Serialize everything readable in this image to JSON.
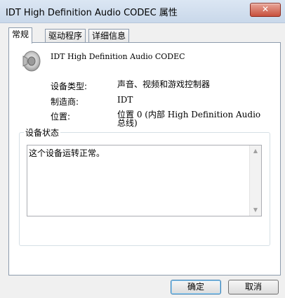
{
  "window": {
    "title": "IDT High Definition Audio CODEC 属性",
    "close_glyph": "✕"
  },
  "tabs": [
    {
      "label": "常规",
      "active": true
    },
    {
      "label": "驱动程序",
      "active": false
    },
    {
      "label": "详细信息",
      "active": false
    }
  ],
  "device": {
    "name": "IDT High Definition Audio CODEC",
    "icon": "speaker-icon",
    "properties": [
      {
        "label": "设备类型:",
        "value": "声音、视频和游戏控制器"
      },
      {
        "label": "制造商:",
        "value": "IDT"
      },
      {
        "label": "位置:",
        "value": "位置 0 (内部 High Definition Audio\n总线)"
      }
    ]
  },
  "status": {
    "legend": "设备状态",
    "text": "这个设备运转正常。"
  },
  "buttons": {
    "ok": "确定",
    "cancel": "取消"
  }
}
